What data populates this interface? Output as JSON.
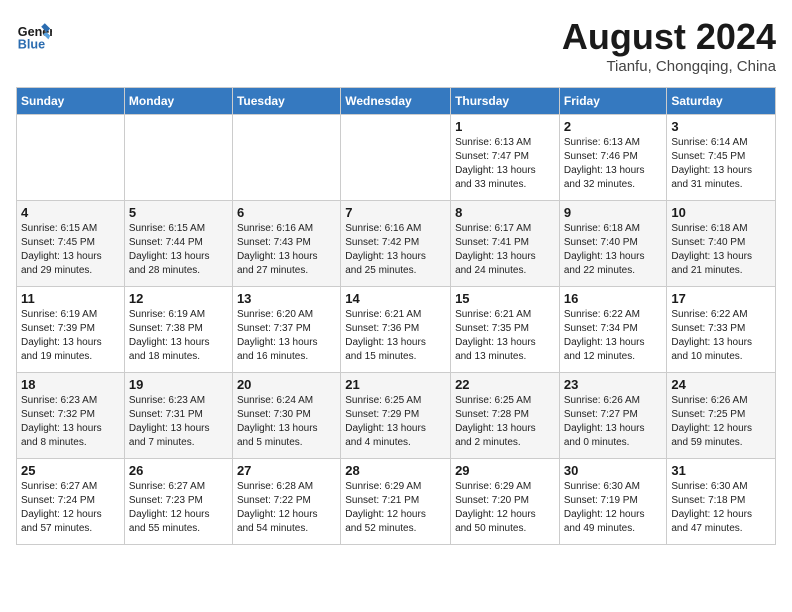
{
  "header": {
    "logo_line1": "General",
    "logo_line2": "Blue",
    "month_title": "August 2024",
    "location": "Tianfu, Chongqing, China"
  },
  "weekdays": [
    "Sunday",
    "Monday",
    "Tuesday",
    "Wednesday",
    "Thursday",
    "Friday",
    "Saturday"
  ],
  "weeks": [
    [
      {
        "day": "",
        "info": ""
      },
      {
        "day": "",
        "info": ""
      },
      {
        "day": "",
        "info": ""
      },
      {
        "day": "",
        "info": ""
      },
      {
        "day": "1",
        "info": "Sunrise: 6:13 AM\nSunset: 7:47 PM\nDaylight: 13 hours\nand 33 minutes."
      },
      {
        "day": "2",
        "info": "Sunrise: 6:13 AM\nSunset: 7:46 PM\nDaylight: 13 hours\nand 32 minutes."
      },
      {
        "day": "3",
        "info": "Sunrise: 6:14 AM\nSunset: 7:45 PM\nDaylight: 13 hours\nand 31 minutes."
      }
    ],
    [
      {
        "day": "4",
        "info": "Sunrise: 6:15 AM\nSunset: 7:45 PM\nDaylight: 13 hours\nand 29 minutes."
      },
      {
        "day": "5",
        "info": "Sunrise: 6:15 AM\nSunset: 7:44 PM\nDaylight: 13 hours\nand 28 minutes."
      },
      {
        "day": "6",
        "info": "Sunrise: 6:16 AM\nSunset: 7:43 PM\nDaylight: 13 hours\nand 27 minutes."
      },
      {
        "day": "7",
        "info": "Sunrise: 6:16 AM\nSunset: 7:42 PM\nDaylight: 13 hours\nand 25 minutes."
      },
      {
        "day": "8",
        "info": "Sunrise: 6:17 AM\nSunset: 7:41 PM\nDaylight: 13 hours\nand 24 minutes."
      },
      {
        "day": "9",
        "info": "Sunrise: 6:18 AM\nSunset: 7:40 PM\nDaylight: 13 hours\nand 22 minutes."
      },
      {
        "day": "10",
        "info": "Sunrise: 6:18 AM\nSunset: 7:40 PM\nDaylight: 13 hours\nand 21 minutes."
      }
    ],
    [
      {
        "day": "11",
        "info": "Sunrise: 6:19 AM\nSunset: 7:39 PM\nDaylight: 13 hours\nand 19 minutes."
      },
      {
        "day": "12",
        "info": "Sunrise: 6:19 AM\nSunset: 7:38 PM\nDaylight: 13 hours\nand 18 minutes."
      },
      {
        "day": "13",
        "info": "Sunrise: 6:20 AM\nSunset: 7:37 PM\nDaylight: 13 hours\nand 16 minutes."
      },
      {
        "day": "14",
        "info": "Sunrise: 6:21 AM\nSunset: 7:36 PM\nDaylight: 13 hours\nand 15 minutes."
      },
      {
        "day": "15",
        "info": "Sunrise: 6:21 AM\nSunset: 7:35 PM\nDaylight: 13 hours\nand 13 minutes."
      },
      {
        "day": "16",
        "info": "Sunrise: 6:22 AM\nSunset: 7:34 PM\nDaylight: 13 hours\nand 12 minutes."
      },
      {
        "day": "17",
        "info": "Sunrise: 6:22 AM\nSunset: 7:33 PM\nDaylight: 13 hours\nand 10 minutes."
      }
    ],
    [
      {
        "day": "18",
        "info": "Sunrise: 6:23 AM\nSunset: 7:32 PM\nDaylight: 13 hours\nand 8 minutes."
      },
      {
        "day": "19",
        "info": "Sunrise: 6:23 AM\nSunset: 7:31 PM\nDaylight: 13 hours\nand 7 minutes."
      },
      {
        "day": "20",
        "info": "Sunrise: 6:24 AM\nSunset: 7:30 PM\nDaylight: 13 hours\nand 5 minutes."
      },
      {
        "day": "21",
        "info": "Sunrise: 6:25 AM\nSunset: 7:29 PM\nDaylight: 13 hours\nand 4 minutes."
      },
      {
        "day": "22",
        "info": "Sunrise: 6:25 AM\nSunset: 7:28 PM\nDaylight: 13 hours\nand 2 minutes."
      },
      {
        "day": "23",
        "info": "Sunrise: 6:26 AM\nSunset: 7:27 PM\nDaylight: 13 hours\nand 0 minutes."
      },
      {
        "day": "24",
        "info": "Sunrise: 6:26 AM\nSunset: 7:25 PM\nDaylight: 12 hours\nand 59 minutes."
      }
    ],
    [
      {
        "day": "25",
        "info": "Sunrise: 6:27 AM\nSunset: 7:24 PM\nDaylight: 12 hours\nand 57 minutes."
      },
      {
        "day": "26",
        "info": "Sunrise: 6:27 AM\nSunset: 7:23 PM\nDaylight: 12 hours\nand 55 minutes."
      },
      {
        "day": "27",
        "info": "Sunrise: 6:28 AM\nSunset: 7:22 PM\nDaylight: 12 hours\nand 54 minutes."
      },
      {
        "day": "28",
        "info": "Sunrise: 6:29 AM\nSunset: 7:21 PM\nDaylight: 12 hours\nand 52 minutes."
      },
      {
        "day": "29",
        "info": "Sunrise: 6:29 AM\nSunset: 7:20 PM\nDaylight: 12 hours\nand 50 minutes."
      },
      {
        "day": "30",
        "info": "Sunrise: 6:30 AM\nSunset: 7:19 PM\nDaylight: 12 hours\nand 49 minutes."
      },
      {
        "day": "31",
        "info": "Sunrise: 6:30 AM\nSunset: 7:18 PM\nDaylight: 12 hours\nand 47 minutes."
      }
    ]
  ]
}
